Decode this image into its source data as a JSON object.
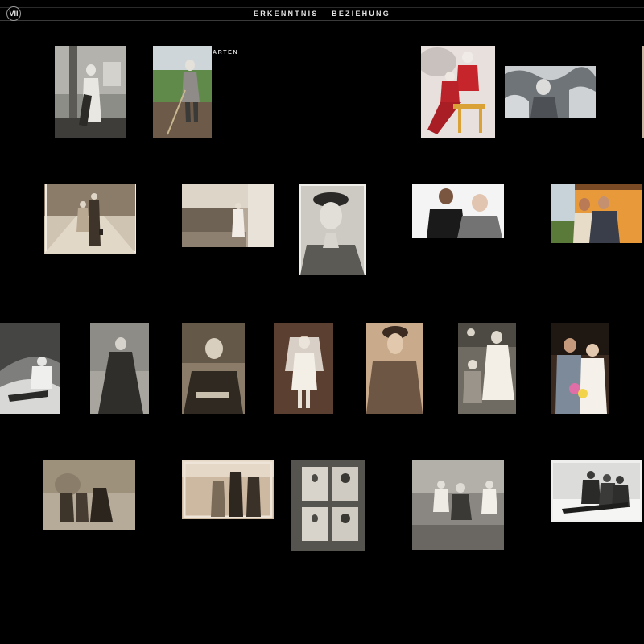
{
  "header": {
    "chapter": "VII",
    "title": "ERKENNTNIS – BEZIEHUNG",
    "marker_text": "ARTEN"
  },
  "photos": [
    {
      "id": "p1",
      "tone": "bw"
    },
    {
      "id": "p2",
      "tone": "color-field"
    },
    {
      "id": "p3",
      "tone": "color-red"
    },
    {
      "id": "p4",
      "tone": "bw-snow"
    },
    {
      "id": "p5",
      "tone": "sepia"
    },
    {
      "id": "p6",
      "tone": "sepia"
    },
    {
      "id": "p7",
      "tone": "sepia-portrait"
    },
    {
      "id": "p8",
      "tone": "color"
    },
    {
      "id": "p9",
      "tone": "color-warm"
    },
    {
      "id": "p10",
      "tone": "bw-snow"
    },
    {
      "id": "p11",
      "tone": "bw-portrait"
    },
    {
      "id": "p12",
      "tone": "sepia-portrait"
    },
    {
      "id": "p13",
      "tone": "sepia-bride"
    },
    {
      "id": "p14",
      "tone": "sepia-portrait"
    },
    {
      "id": "p15",
      "tone": "sepia"
    },
    {
      "id": "p16",
      "tone": "color-couple"
    },
    {
      "id": "p17",
      "tone": "sepia"
    },
    {
      "id": "p18",
      "tone": "sepia"
    },
    {
      "id": "p19",
      "tone": "album"
    },
    {
      "id": "p20",
      "tone": "bw"
    },
    {
      "id": "p21",
      "tone": "bw-snow"
    }
  ]
}
